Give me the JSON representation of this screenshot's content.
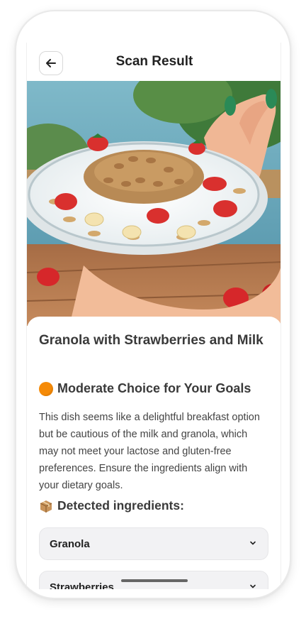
{
  "header": {
    "title": "Scan Result",
    "back_icon": "arrow-left-icon"
  },
  "photo": {
    "subject": "food-photo"
  },
  "result": {
    "dish_name": "Granola with Strawberries and Milk",
    "verdict_icon": "orange-circle-icon",
    "verdict_color": "#f58a07",
    "verdict_label": "Moderate Choice for Your Goals",
    "description": "This dish seems like a delightful breakfast option but be cautious of the milk and granola, which may not meet your lactose and gluten-free preferences. Ensure the ingredients align with your dietary goals.",
    "ingredients_icon": "package-icon",
    "ingredients_heading": "Detected ingredients:",
    "ingredients": [
      {
        "label": "Granola"
      },
      {
        "label": "Strawberries"
      }
    ]
  }
}
